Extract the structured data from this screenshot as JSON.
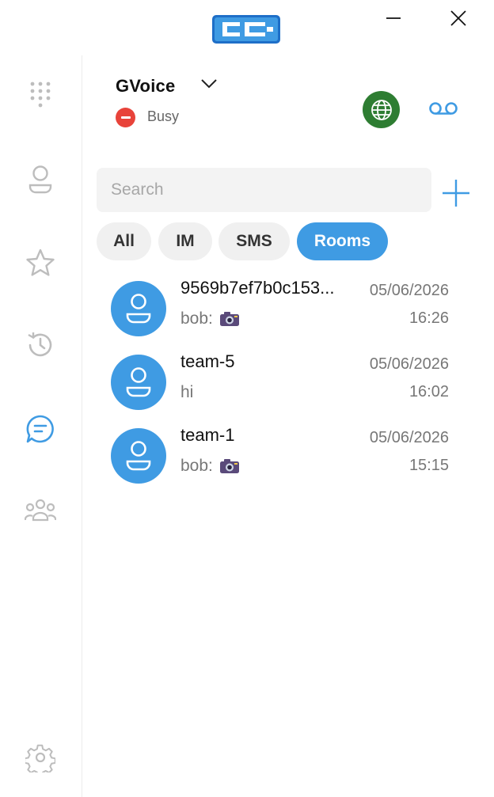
{
  "window": {
    "minimize_icon": "minimize-icon",
    "close_icon": "close-icon"
  },
  "sidebar": {
    "items": [
      {
        "name": "dialpad",
        "icon": "dialpad-icon"
      },
      {
        "name": "contacts",
        "icon": "person-icon"
      },
      {
        "name": "favorites",
        "icon": "star-icon"
      },
      {
        "name": "history",
        "icon": "history-icon"
      },
      {
        "name": "messages",
        "icon": "chat-icon",
        "active": true
      },
      {
        "name": "groups",
        "icon": "group-icon"
      },
      {
        "name": "settings",
        "icon": "gear-icon"
      }
    ]
  },
  "account": {
    "name": "GVoice",
    "status": "Busy",
    "status_color": "#e8433a"
  },
  "header_actions": {
    "globe_color": "#2e7d32",
    "voicemail_color": "#3f9be3"
  },
  "search": {
    "placeholder": "Search"
  },
  "tabs": [
    {
      "label": "All",
      "active": false
    },
    {
      "label": "IM",
      "active": false
    },
    {
      "label": "SMS",
      "active": false
    },
    {
      "label": "Rooms",
      "active": true
    }
  ],
  "accent_color": "#3f9be3",
  "conversations": [
    {
      "name": "9569b7ef7b0c153...",
      "date": "05/06/2026",
      "time": "16:26",
      "preview": "bob:",
      "preview_icon": "camera-icon"
    },
    {
      "name": "team-5",
      "date": "05/06/2026",
      "time": "16:02",
      "preview": "hi",
      "preview_icon": ""
    },
    {
      "name": "team-1",
      "date": "05/06/2026",
      "time": "15:15",
      "preview": "bob:",
      "preview_icon": "camera-icon"
    }
  ]
}
